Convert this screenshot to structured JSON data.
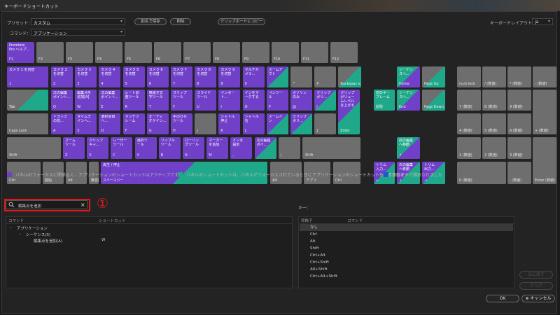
{
  "window_title": "キーボードショートカット",
  "preset": {
    "label": "プリセット：",
    "value": "カスタム"
  },
  "command": {
    "label": "コマンド：",
    "value": "アプリケーション"
  },
  "buttons": {
    "save_as": "別名で保存",
    "delete": "削除",
    "copy_clipboard": "クリップボードにコピー",
    "ok": "OK",
    "cancel": "キャンセル",
    "clear": "クリア",
    "undo": "元に戻す"
  },
  "layout": {
    "label": "キーボードレイアウト：",
    "value": "ja"
  },
  "keys": {
    "f_row": [
      {
        "top": "Premiere\nPro ヘルプ...",
        "bot": "F1"
      },
      {
        "top": "",
        "bot": "F2"
      },
      {
        "top": "",
        "bot": "F3"
      },
      {
        "top": "",
        "bot": "F4"
      },
      {
        "top": "",
        "bot": "F5"
      },
      {
        "top": "",
        "bot": "F6"
      },
      {
        "top": "",
        "bot": "F7"
      },
      {
        "top": "",
        "bot": "F8"
      },
      {
        "top": "",
        "bot": "F9"
      },
      {
        "top": "",
        "bot": "F10"
      },
      {
        "top": "",
        "bot": "F11"
      },
      {
        "top": "",
        "bot": "F12"
      }
    ],
    "num_row": [
      {
        "top": "カメラ 1 を切替",
        "bot": "1"
      },
      {
        "top": "カメラ 2\nを切替",
        "bot": "2"
      },
      {
        "top": "カメラ 3\nを切替",
        "bot": "3"
      },
      {
        "top": "カメラ 4\nを切替",
        "bot": "4"
      },
      {
        "top": "カメラ 5\nを切替",
        "bot": "5"
      },
      {
        "top": "カメラ 6\nを切替",
        "bot": "6"
      },
      {
        "top": "カメラ 7\nを切替",
        "bot": "7"
      },
      {
        "top": "カメラ 8\nを切替",
        "bot": "8"
      },
      {
        "top": "カメラ 9\nを切替",
        "bot": "9"
      },
      {
        "top": "マルチカ\nメラ...",
        "bot": "0"
      },
      {
        "top": "ズームア\nウト",
        "bot": "-"
      },
      {
        "top": "",
        "bot": "^"
      },
      {
        "top": "",
        "bot": "¥"
      },
      {
        "top": "",
        "bot": "Backspac\ne"
      }
    ],
    "q_row": [
      {
        "top": "",
        "bot": "Tab"
      },
      {
        "top": "次の編集\nポイント...",
        "bot": "Q"
      },
      {
        "top": "編集点を\n追加[A]",
        "bot": "W"
      },
      {
        "top": "次の編集\nポイント...",
        "bot": "E"
      },
      {
        "top": "レート調\n整ツール",
        "bot": "R"
      },
      {
        "top": "横書き文\n字ツール",
        "bot": "T"
      },
      {
        "top": "スリップ\nツール",
        "bot": "Y"
      },
      {
        "top": "スライド\nツール",
        "bot": "U"
      },
      {
        "top": "インポー\nト...",
        "bot": "I"
      },
      {
        "top": "インをマ\nークする",
        "bot": "O"
      },
      {
        "top": "ペンツー\nル",
        "bot": "P"
      },
      {
        "top": "ガソリン\nのみ",
        "bot": "@"
      },
      {
        "top": "クリップ\nボリ...",
        "bot": "["
      },
      {
        "top": "クリップ\nボリュー\nムレベル\nを上げる",
        "bot": "Enter"
      }
    ],
    "a_row": [
      {
        "top": "",
        "bot": "Caps Lock"
      },
      {
        "top": "トラック\nの前...",
        "bot": "A"
      },
      {
        "top": "タイムラ\nインへ...",
        "bot": "S"
      },
      {
        "top": "選択項目\nへ...",
        "bot": "D"
      },
      {
        "top": "マッチフ\nレーム",
        "bot": "F"
      },
      {
        "top": "オーディ\nオゲイン...",
        "bot": "G"
      },
      {
        "top": "手のひら\nツール",
        "bot": "H"
      },
      {
        "top": "",
        "bot": "J"
      },
      {
        "top": "シャトル\n停止",
        "bot": "K"
      },
      {
        "top": "シャトル\n右",
        "bot": "L"
      },
      {
        "top": "ズームイ\nン",
        "bot": ";"
      },
      {
        "top": "クリップ\nボリ...",
        "bot": ":"
      },
      {
        "top": "",
        "bot": "]"
      }
    ],
    "z_row": [
      {
        "top": "",
        "bot": "Shift"
      },
      {
        "top": "ズーム\nツール",
        "bot": "Z"
      },
      {
        "top": "クリップ\nキャ...",
        "bot": "X"
      },
      {
        "top": "レーザー\nツール",
        "bot": "C"
      },
      {
        "top": "選択ツ\nール",
        "bot": "V"
      },
      {
        "top": "リップル\nツール",
        "bot": "B"
      },
      {
        "top": "ローリン\nグツール",
        "bot": "N"
      },
      {
        "top": "マーカー\nを追加",
        "bot": "M"
      },
      {
        "top": "インを\n設定",
        "bot": ","
      },
      {
        "top": "次の編集\nポイ...",
        "bot": "."
      },
      {
        "top": "",
        "bot": "/"
      },
      {
        "top": "",
        "bot": "\\"
      },
      {
        "top": "",
        "bot": "Shift"
      }
    ],
    "ctrl_row": [
      {
        "top": "",
        "bot": "Ctrl"
      },
      {
        "top": "",
        "bot": "開始"
      },
      {
        "top": "",
        "bot": "Alt"
      },
      {
        "top": "",
        "bot": "無変換"
      },
      {
        "top": "再生 / 停止",
        "bot": "スペースバー"
      },
      {
        "top": "",
        "bot": "変換"
      },
      {
        "top": "",
        "bot": "Alt"
      },
      {
        "top": "",
        "bot": "アプリ"
      },
      {
        "top": "",
        "bot": "Ctrl"
      }
    ],
    "nav": [
      {
        "top": "シーケン\nスへ...",
        "bot": "Home"
      },
      {
        "top": "",
        "bot": "Page Up"
      },
      {
        "top": "前のキー\nフレーム",
        "bot": "削除"
      },
      {
        "top": "シーケン\nスへ...",
        "bot": "End"
      },
      {
        "top": "",
        "bot": "Page\nDown"
      },
      {
        "top": "前の編集\nへ移動",
        "bot": "↑"
      },
      {
        "top": "トリム\n入力...",
        "bot": "←"
      },
      {
        "top": "次の編集\nへ移動",
        "bot": "↓"
      },
      {
        "top": "トリム\n出力...",
        "bot": "→"
      }
    ],
    "numpad": [
      {
        "bot": "num lock"
      },
      {
        "bot": "/ (数値)"
      },
      {
        "bot": "* (数値)"
      },
      {
        "bot": "- (数値)"
      },
      {
        "bot": "7 (数値)"
      },
      {
        "bot": "8 (数値)"
      },
      {
        "bot": "9 (数値)"
      },
      {
        "bot": "+ (数値)"
      },
      {
        "bot": "4 (数値)"
      },
      {
        "bot": "5 (数値)"
      },
      {
        "bot": "6 (数値)"
      },
      {
        "bot": "1 (数値)"
      },
      {
        "bot": "2 (数値)"
      },
      {
        "bot": "3 (数値)"
      },
      {
        "bot": "Enter (数値)"
      },
      {
        "bot": "0 (数値)"
      },
      {
        "bot": ". (数値)"
      }
    ]
  },
  "legend": {
    "app": "パネルのフォーカスに関係なく、アプリケーションのショートカットはアクティブです",
    "panel": "パネルのショートカットは、パネルがフォーカスされているときにアプリケーションのショートカットを上書きします",
    "modifier": "修飾キーが選択されました",
    "colors": {
      "app": "#7040c8",
      "panel": "#1fa98a",
      "modifier": "#1a5cc8"
    }
  },
  "search": {
    "value": "編集点を追加",
    "icon": "search-icon",
    "clear": "×"
  },
  "callout": "①",
  "key_label": "キー：",
  "left_table": {
    "headers": [
      "コマンド",
      "ショートカット"
    ],
    "rows": [
      {
        "name": "アプリケーション",
        "shortcut": ""
      },
      {
        "name": "シーケンス(S)",
        "shortcut": ""
      },
      {
        "name": "編集点を追加(A)",
        "shortcut": "W"
      }
    ]
  },
  "right_table": {
    "headers": [
      "修飾子",
      "コマンド"
    ],
    "rows": [
      "なし",
      "Ctrl",
      "Alt",
      "Shift",
      "Ctrl+Alt",
      "Ctrl+Shift",
      "Alt+Shift",
      "Ctrl+Alt+Shift"
    ]
  }
}
